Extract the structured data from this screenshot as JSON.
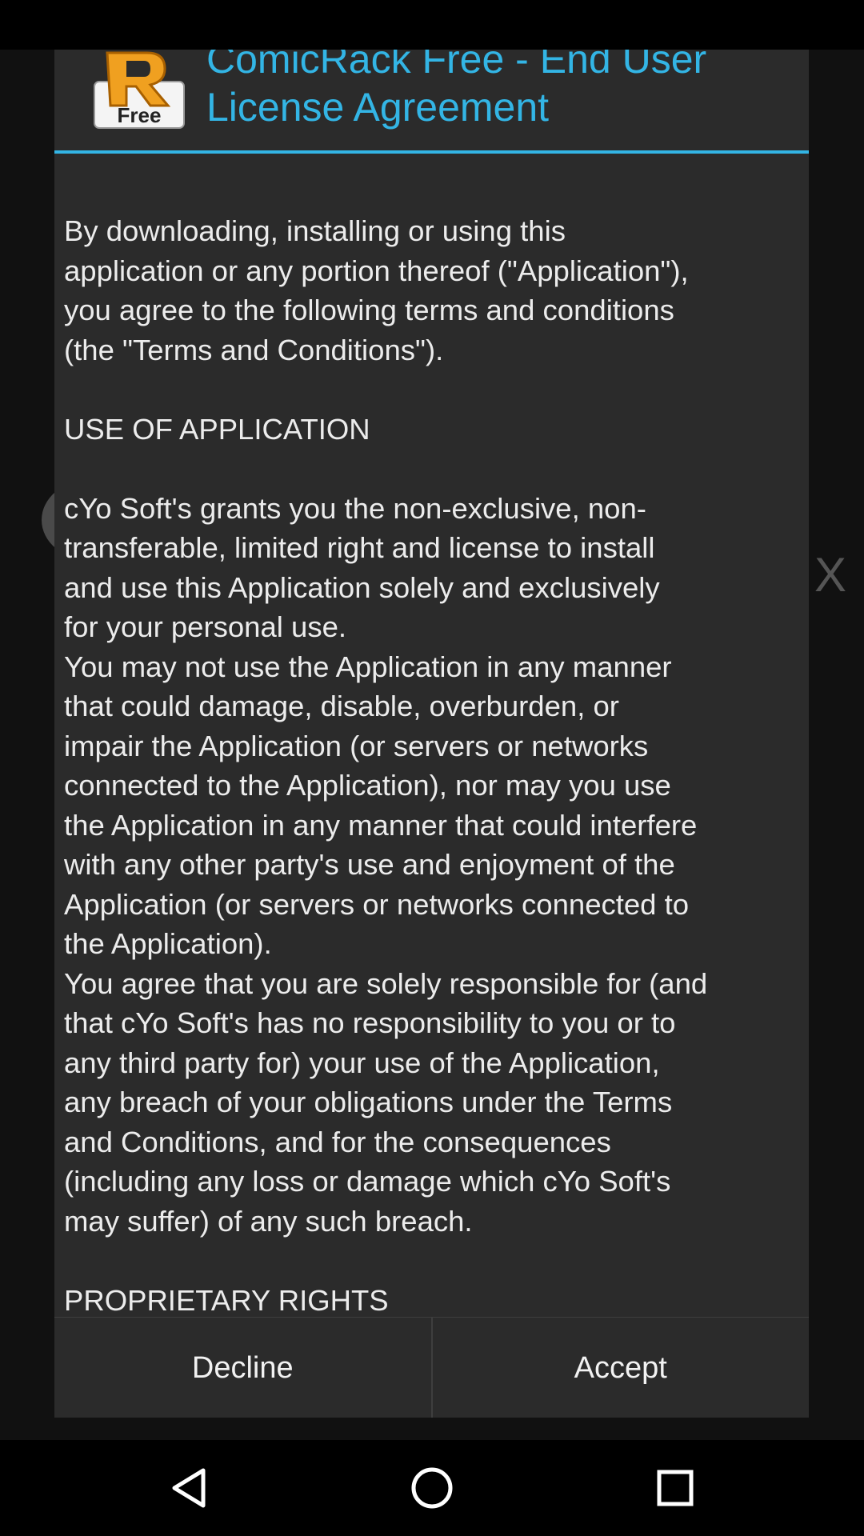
{
  "dialog": {
    "title": "ComicRack Free - End User License Agreement",
    "logo": {
      "icon": "comicrack-logo-icon",
      "badge_text": "Free"
    },
    "license_text": "By downloading, installing or using this\napplication or any portion thereof (\"Application\"),\nyou agree to the following terms and conditions\n(the \"Terms and Conditions\").\n\nUSE OF APPLICATION\n\ncYo Soft's grants you the non-exclusive, non-\ntransferable, limited right and license to install\nand use this Application solely and exclusively\nfor your personal use.\nYou may not use the Application in any manner\nthat could damage, disable, overburden, or\nimpair the Application (or servers or networks\nconnected to the Application), nor may you use\nthe Application in any manner that could interfere\nwith any other party's use and enjoyment of the\nApplication (or servers or networks connected to\nthe Application).\nYou agree that you are solely responsible for (and\nthat cYo Soft's has no responsibility to you or to\nany third party for) your use of the Application,\nany breach of your obligations under the Terms\nand Conditions, and for the consequences\n(including any loss or damage which cYo Soft's\nmay suffer) of any such breach.\n\nPROPRIETARY RIGHTS\nYou acknowledge that (a) the Application",
    "buttons": {
      "decline": "Decline",
      "accept": "Accept"
    }
  },
  "nav_bar": {
    "back_icon": "back-triangle-icon",
    "home_icon": "home-circle-icon",
    "recents_icon": "recents-square-icon"
  },
  "colors": {
    "accent": "#33b5e5",
    "dialog_bg": "#2b2b2b",
    "text": "#ececec"
  }
}
